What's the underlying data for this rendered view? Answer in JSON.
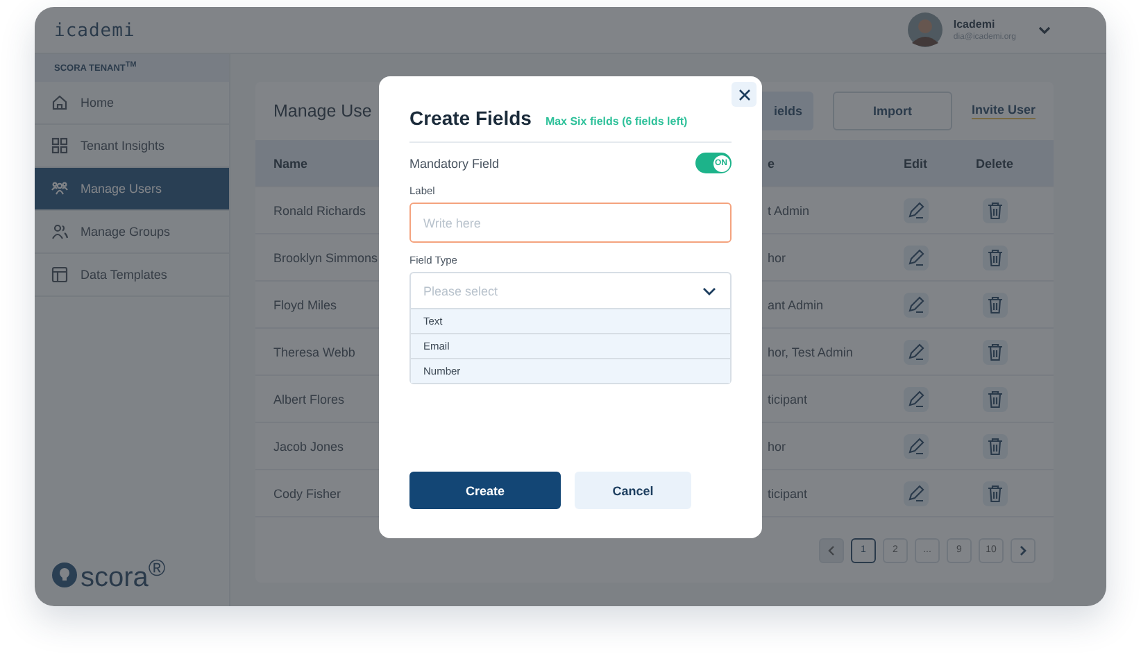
{
  "header": {
    "logo": "icademi",
    "user": {
      "name": "Icademi",
      "email": "dia@icademi.org"
    }
  },
  "sidebar": {
    "tenant": "SCORA TENANT$^{TM}$",
    "items": [
      {
        "label": "Home",
        "kind": "home",
        "selected": false
      },
      {
        "label": "Tenant Insights",
        "kind": "insights",
        "selected": false
      },
      {
        "label": "Manage Users",
        "kind": "users",
        "selected": true
      },
      {
        "label": "Manage Groups",
        "kind": "groups",
        "selected": false
      },
      {
        "label": "Data Templates",
        "kind": "templates",
        "selected": false
      }
    ],
    "footer_logo": "scora$^{®}$"
  },
  "page": {
    "title": "Manage Use",
    "actions": [
      {
        "label": "ields",
        "kind": "secondary"
      },
      {
        "label": "Import",
        "kind": "outline"
      },
      {
        "label": "Invite User",
        "kind": "link"
      }
    ]
  },
  "table": {
    "columns": [
      "Name",
      "e",
      "Edit",
      "Delete"
    ],
    "rows": [
      {
        "name": "Ronald Richards",
        "column_2": "t Admin"
      },
      {
        "name": "Brooklyn Simmons",
        "column_2": "hor"
      },
      {
        "name": "Floyd Miles",
        "column_2": "ant Admin"
      },
      {
        "name": "Theresa Webb",
        "column_2": "hor, Test Admin"
      },
      {
        "name": "Albert Flores",
        "column_2": "ticipant"
      },
      {
        "name": "Jacob Jones",
        "column_2": "hor"
      },
      {
        "name": "Cody Fisher",
        "column_2": "ticipant"
      }
    ]
  },
  "pagination": [
    {
      "label": "1",
      "selected": true
    },
    {
      "label": "2",
      "selected": false
    },
    {
      "label": "...",
      "selected": false
    },
    {
      "label": "9",
      "selected": false
    },
    {
      "label": "10",
      "selected": false
    }
  ],
  "modal": {
    "title": "Create Fields",
    "note": "Max Six fields (6 fields left)",
    "mandatory": {
      "label": "Mandatory Field",
      "on": true,
      "knob": "ON"
    },
    "label_field": {
      "label": "Label",
      "placeholder": "Write here",
      "focused": true
    },
    "type_field": {
      "label": "Field Type",
      "placeholder": "Please select",
      "expanded": true,
      "options": [
        "Text",
        "Email",
        "Number"
      ]
    },
    "buttons": [
      {
        "label": "Create",
        "kind": "primary"
      },
      {
        "label": "Cancel",
        "kind": "secondary"
      }
    ]
  }
}
